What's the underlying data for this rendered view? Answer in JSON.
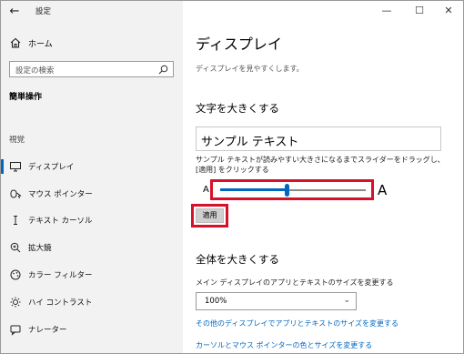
{
  "app": {
    "title": "設定"
  },
  "sidebar": {
    "home_label": "ホーム",
    "search_placeholder": "設定の検索",
    "section_title": "簡単操作",
    "group_vision": "視覚",
    "items": [
      {
        "label": "ディスプレイ",
        "icon": "monitor-icon",
        "active": true
      },
      {
        "label": "マウス ポインター",
        "icon": "mouse-pointer-icon"
      },
      {
        "label": "テキスト カーソル",
        "icon": "text-cursor-icon"
      },
      {
        "label": "拡大鏡",
        "icon": "magnifier-icon"
      },
      {
        "label": "カラー フィルター",
        "icon": "color-filter-icon"
      },
      {
        "label": "ハイ コントラスト",
        "icon": "high-contrast-icon"
      },
      {
        "label": "ナレーター",
        "icon": "narrator-icon"
      }
    ]
  },
  "main": {
    "title": "ディスプレイ",
    "subtitle": "ディスプレイを見やすくします。",
    "text_section": {
      "heading": "文字を大きくする",
      "sample_text": "サンプル テキスト",
      "instruction": "サンプル テキストが読みやすい大きさになるまでスライダーをドラッグし、[適用] をクリックする",
      "slider_min_label": "A",
      "slider_max_label": "A",
      "slider_value": 0.46,
      "apply_label": "適用"
    },
    "all_section": {
      "heading": "全体を大きくする",
      "scale_label": "メイン ディスプレイのアプリとテキストのサイズを変更する",
      "scale_value": "100%",
      "link_other_displays": "その他のディスプレイでアプリとテキストのサイズを変更する",
      "link_cursor": "カーソルとマウス ポインターの色とサイズを変更する"
    }
  },
  "colors": {
    "accent": "#0067c0",
    "highlight": "#d8112a",
    "sidebar_bg": "#f2f2f2"
  }
}
